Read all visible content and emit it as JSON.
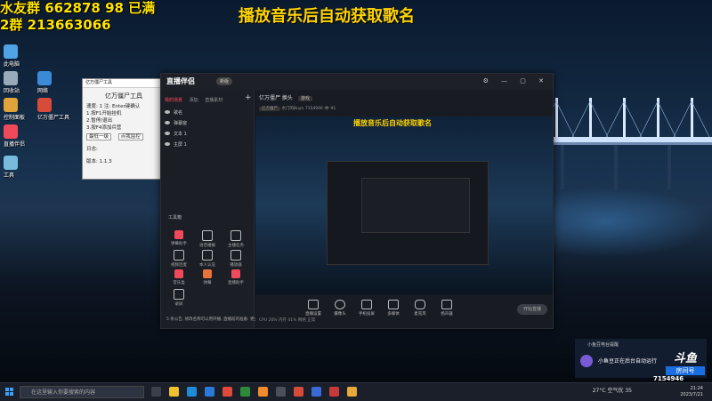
{
  "overlay": {
    "line1": "水友群 662878 98 已满",
    "line2": "2群 213663066"
  },
  "banner": "播放音乐后自动获取歌名",
  "desktop_icons": [
    {
      "label": "此电脑",
      "color": "#4fa3e6"
    },
    {
      "label": "回收站",
      "color": "#9ab"
    },
    {
      "label": "网络",
      "color": "#3a8ad8"
    },
    {
      "label": "控制面板",
      "color": "#e0a43a"
    },
    {
      "label": "亿万僵尸工具",
      "color": "#d84a3a"
    },
    {
      "label": "直播伴侣",
      "color": "#f04a5a"
    },
    {
      "label": "工具",
      "color": "#7bd"
    }
  ],
  "tool_window": {
    "title": "亿万僵尸工具",
    "rows": [
      "速度: 1  注: Enter键确认",
      "1.按F1开始挂机",
      "2.暂停/退出",
      "3.按F4添加兵营",
      "日志:",
      "版本: 1.1.3"
    ],
    "buttons": [
      "最低一级",
      "点我监控"
    ]
  },
  "app": {
    "logo": "直播伴侣",
    "version": "新版",
    "tabs": [
      "我的场景",
      "添加",
      "直播素材"
    ],
    "scenes": [
      "歌名",
      "弹幕窗",
      "文本 1",
      "主屏 1"
    ],
    "tools_label": "工具箱",
    "tools": [
      "弹幕助手",
      "语音播报",
      "主播任务",
      "视频连麦",
      "本人认证",
      "播放器",
      "音乐盒",
      "弹幕",
      "直播助手",
      "录屏"
    ],
    "notice": "5 条公告, 修改名称可以用开播, 直播前的准备: 更多",
    "room_title": "亿万僵尸 换头",
    "room_tag": "游戏",
    "room_info": "亿万僵尸",
    "room_owner": "水门的Buyn",
    "room_id": "7154946",
    "viewers": "91",
    "bottom": [
      "直播设置",
      "摄像头",
      "手机投屏",
      "多媒体",
      "麦克风",
      "扬声器"
    ],
    "start_btn": "开始直播",
    "status": "CPU 26%  内存 41%  网络 正常"
  },
  "notification": {
    "title": "小鱼豆电台提醒",
    "text": "小鱼豆正在后台自动运行"
  },
  "douyu": {
    "logo": "斗鱼",
    "tag": "房间号",
    "room": "7154946"
  },
  "taskbar": {
    "search_placeholder": "在这里输入你要搜索的内容",
    "weather": "27°C 空气优 35",
    "time": "21:24",
    "date": "2023/7/21"
  }
}
